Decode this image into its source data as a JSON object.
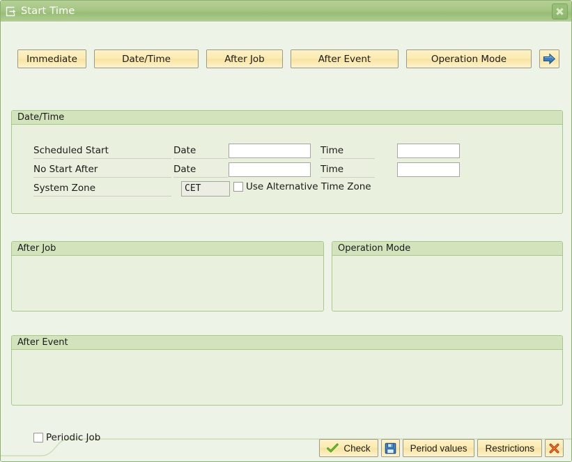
{
  "window": {
    "title": "Start Time",
    "title_icon": "dialog-popup-icon",
    "close_icon": "close-icon",
    "accent_title_green": "#a5c684",
    "panel_bg": "#e9f1de",
    "panel_header_bg": "#d3e4bd",
    "dialog_bg": "#eef3e7",
    "button_yellow": "#fbeab0"
  },
  "toolbar": {
    "buttons": [
      {
        "label": "Immediate"
      },
      {
        "label": "Date/Time"
      },
      {
        "label": "After Job"
      },
      {
        "label": "After Event"
      },
      {
        "label": "Operation Mode"
      }
    ],
    "next_icon": "arrow-right-icon"
  },
  "date_time_group": {
    "title": "Date/Time",
    "rows": [
      {
        "label": "Scheduled Start",
        "date_label": "Date",
        "date_value": "",
        "date_placeholder": "",
        "time_label": "Time",
        "time_value": "",
        "time_placeholder": ""
      },
      {
        "label": "No Start After",
        "date_label": "Date",
        "date_value": "",
        "date_placeholder": "",
        "time_label": "Time",
        "time_value": "",
        "time_placeholder": ""
      }
    ],
    "system_zone": {
      "label": "System Zone",
      "value": "CET",
      "alt_zone_checkbox_label": "Use Alternative Time Zone",
      "alt_zone_checked": false
    }
  },
  "after_job_group": {
    "title": "After Job",
    "content": ""
  },
  "operation_mode_group": {
    "title": "Operation Mode",
    "content": ""
  },
  "after_event_group": {
    "title": "After Event",
    "content": ""
  },
  "periodic_job": {
    "label": "Periodic Job",
    "checked": false
  },
  "footer": {
    "check_label": "Check",
    "check_icon": "green-checkmark-icon",
    "save_icon": "floppy-save-icon",
    "period_values_label": "Period values",
    "restrictions_label": "Restrictions",
    "cancel_icon": "red-x-cancel-icon"
  }
}
